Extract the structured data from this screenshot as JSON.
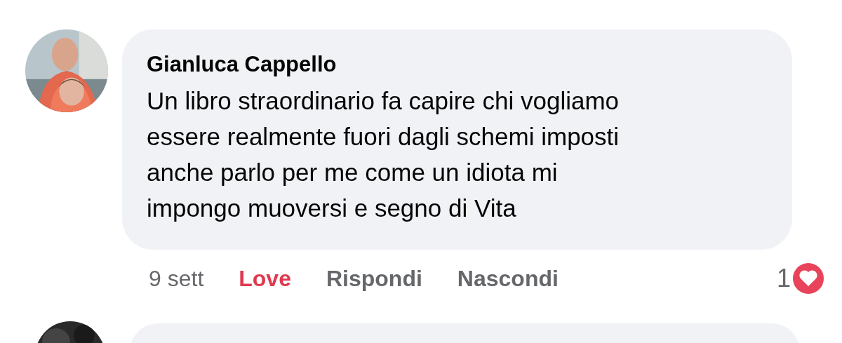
{
  "comment": {
    "author": "Gianluca Cappello",
    "text": "Un libro straordinario fa capire chi vogliamo\nessere realmente fuori dagli schemi imposti\nanche parlo per me come un idiota mi\nimpongo muoversi e segno di Vita",
    "actions": [
      {
        "label": "9 sett",
        "kind": "time"
      },
      {
        "label": "Love",
        "kind": "reaction"
      },
      {
        "label": "Rispondi",
        "kind": "action"
      },
      {
        "label": "Nascondi",
        "kind": "action"
      }
    ],
    "reactions": {
      "count": "1",
      "kind": "love"
    }
  }
}
